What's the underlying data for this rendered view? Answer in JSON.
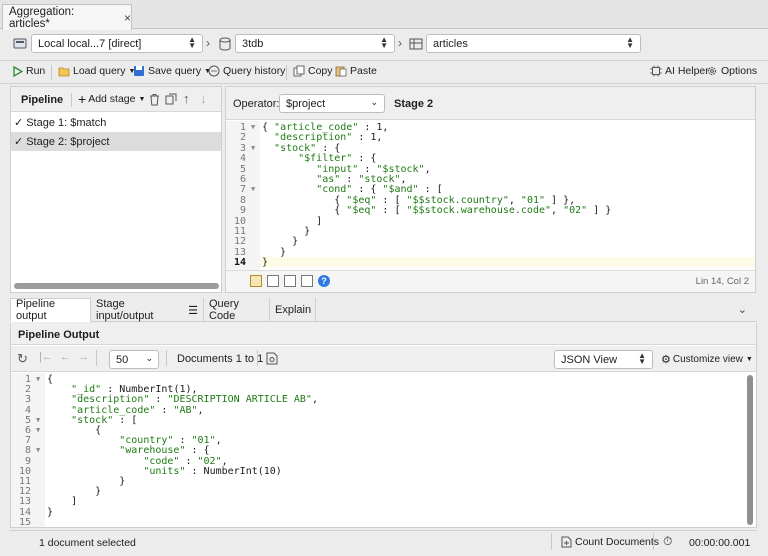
{
  "tab": {
    "title": "Aggregation: articles*",
    "close": "×"
  },
  "connection": {
    "server": "Local local...7 [direct]",
    "database": "3tdb",
    "collection": "articles"
  },
  "toolbar": {
    "run": "Run",
    "load_query": "Load query",
    "save_query": "Save query",
    "query_history": "Query history",
    "copy": "Copy",
    "paste": "Paste",
    "ai_helper": "AI Helper",
    "options": "Options"
  },
  "pipeline": {
    "title": "Pipeline",
    "add_stage": "Add stage",
    "stages": [
      {
        "label": "Stage 1: $match",
        "checked": true
      },
      {
        "label": "Stage 2: $project",
        "checked": true
      }
    ]
  },
  "editor": {
    "operator_label": "Operator:",
    "operator_value": "$project",
    "stage_name": "Stage 2",
    "cursor_status": "Lin 14, Col 2",
    "current_line": 14,
    "lines": [
      "{ \"article_code\" : 1,",
      "  \"description\" : 1,",
      "  \"stock\" : {",
      "      \"$filter\" : {",
      "         \"input\" : \"$stock\",",
      "         \"as\" : \"stock\",",
      "         \"cond\" : { \"$and\" : [",
      "            { \"$eq\" : [ \"$$stock.country\", \"01\" ] },",
      "            { \"$eq\" : [ \"$$stock.warehouse.code\", \"02\" ] }",
      "         ]",
      "       }",
      "     }",
      "   }",
      "}"
    ]
  },
  "output_tabs": {
    "pipeline_output": "Pipeline output",
    "stage_io": "Stage input/output",
    "query_code": "Query Code",
    "explain": "Explain"
  },
  "output": {
    "title": "Pipeline Output",
    "page_size": "50",
    "documents_range": "Documents 1 to 1",
    "view_mode": "JSON View",
    "customize": "Customize view",
    "lines": [
      "{",
      "    \"_id\" : NumberInt(1),",
      "    \"description\" : \"DESCRIPTION ARTICLE AB\",",
      "    \"article_code\" : \"AB\",",
      "    \"stock\" : [",
      "        {",
      "            \"country\" : \"01\",",
      "            \"warehouse\" : {",
      "                \"code\" : \"02\",",
      "                \"units\" : NumberInt(10)",
      "            }",
      "        }",
      "    ]",
      "}",
      ""
    ]
  },
  "status": {
    "selection": "1 document selected",
    "count_documents": "Count Documents",
    "elapsed": "00:00:00.001"
  }
}
